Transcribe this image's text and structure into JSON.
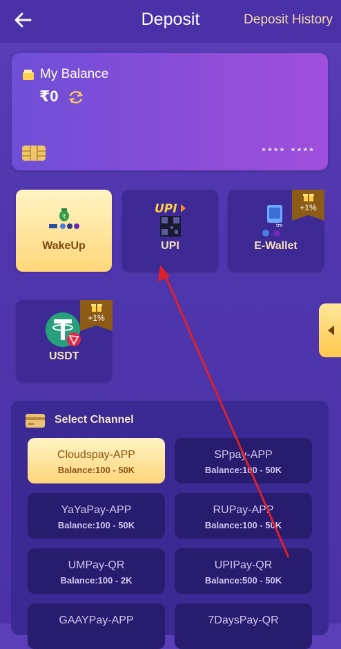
{
  "header": {
    "title": "Deposit",
    "history_label": "Deposit History"
  },
  "balance": {
    "label": "My Balance",
    "amount": "₹0",
    "card_mask": "**** ****"
  },
  "methods": [
    {
      "label": "WakeUp",
      "active": true,
      "icon": "money-bag-icon"
    },
    {
      "label": "UPI",
      "active": false,
      "icon": "upi-qr-icon"
    },
    {
      "label": "E-Wallet",
      "active": false,
      "icon": "e-wallet-icon",
      "bonus": "+1%"
    },
    {
      "label": "USDT",
      "active": false,
      "icon": "tether-icon",
      "bonus": "+1%"
    }
  ],
  "channel_section": {
    "title": "Select Channel"
  },
  "channels": [
    {
      "name": "Cloudspay-APP",
      "balance": "Balance:100 - 50K",
      "active": true
    },
    {
      "name": "SPpay-APP",
      "balance": "Balance:100 - 50K",
      "active": false
    },
    {
      "name": "YaYaPay-APP",
      "balance": "Balance:100 - 50K",
      "active": false
    },
    {
      "name": "RUPay-APP",
      "balance": "Balance:100 - 50K",
      "active": false
    },
    {
      "name": "UMPay-QR",
      "balance": "Balance:100 - 2K",
      "active": false
    },
    {
      "name": "UPIPay-QR",
      "balance": "Balance:500 - 50K",
      "active": false
    },
    {
      "name": "GAAYPay-APP",
      "balance": "",
      "active": false
    },
    {
      "name": "7DaysPay-QR",
      "balance": "",
      "active": false
    }
  ],
  "colors": {
    "accent_gold": "#ffd77a",
    "annotation_arrow": "#e0202a"
  }
}
